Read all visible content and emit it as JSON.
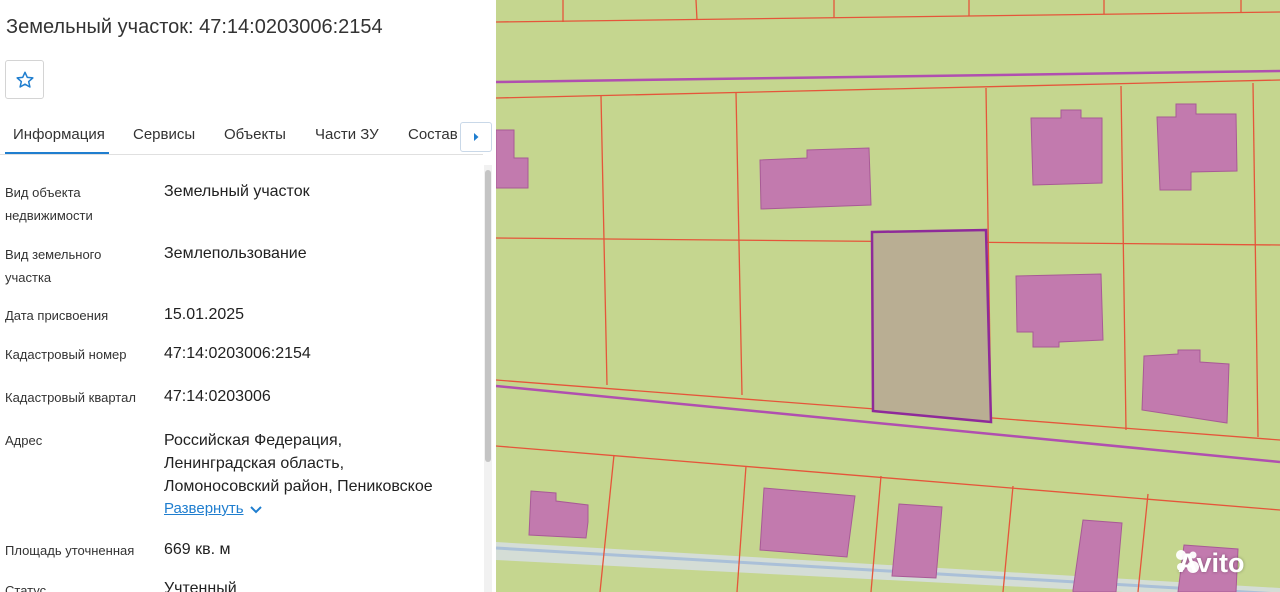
{
  "header": {
    "title": "Земельный участок: 47:14:0203006:2154"
  },
  "favorite": {
    "icon": "star-outline-icon"
  },
  "tabs": [
    {
      "label": "Информация",
      "active": true
    },
    {
      "label": "Сервисы"
    },
    {
      "label": "Объекты"
    },
    {
      "label": "Части ЗУ"
    },
    {
      "label": "Состав"
    }
  ],
  "tabs_next_icon": "caret-right-icon",
  "info": {
    "object_type_label": "Вид объекта недвижимости",
    "object_type_value": "Земельный участок",
    "land_type_label": "Вид земельного участка",
    "land_type_value": "Землепользование",
    "date_label": "Дата присвоения",
    "date_value": "15.01.2025",
    "cad_number_label": "Кадастровый номер",
    "cad_number_value": "47:14:0203006:2154",
    "cad_quarter_label": "Кадастровый квартал",
    "cad_quarter_value": "47:14:0203006",
    "address_label": "Адрес",
    "address_line1": "Российская Федерация,",
    "address_line2": "Ленинградская область,",
    "address_line3": "Ломоносовский район, Пениковское",
    "expand_label": "Развернуть",
    "area_label": "Площадь уточненная",
    "area_value": "669 кв. м",
    "status_label": "Статус",
    "status_value": "Учтенный"
  },
  "watermark": {
    "text": "Avito"
  },
  "colors": {
    "accent": "#1f7ecf",
    "map_background": "#c5d68f",
    "parcel_border": "#e5553a",
    "building_fill": "#c27aae",
    "selected_parcel_fill": "#b9ae93",
    "selected_parcel_border": "#8e2a9a"
  }
}
